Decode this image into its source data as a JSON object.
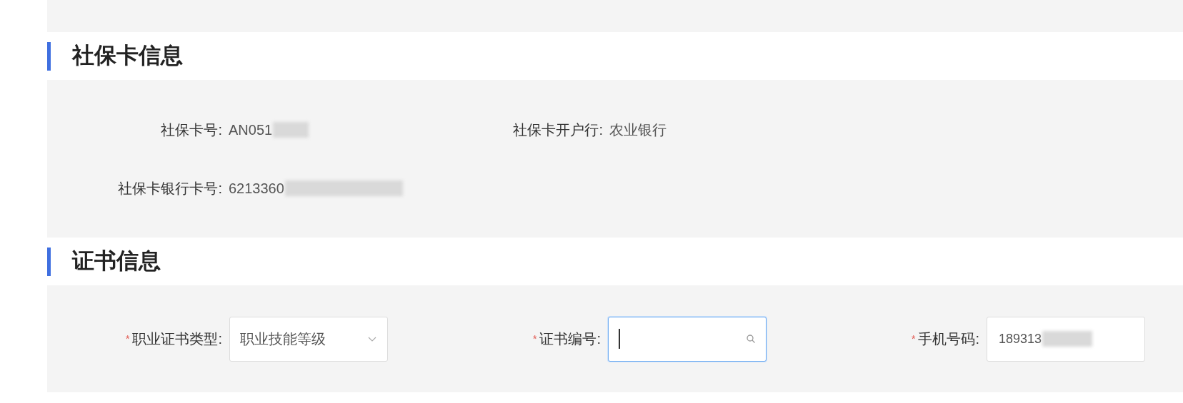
{
  "sections": [
    {
      "title": "社保卡信息",
      "kind": "info",
      "fields": [
        {
          "label": "社保卡号:",
          "value": "AN051",
          "redacted": true
        },
        {
          "label": "社保卡开户行:",
          "value": "农业银行",
          "redacted": false
        },
        {
          "label": "社保卡银行卡号:",
          "value": "6213360",
          "redacted": true
        }
      ]
    },
    {
      "title": "证书信息",
      "kind": "form",
      "fields": [
        {
          "required_mark": "*",
          "label": "职业证书类型:",
          "kind": "select",
          "value": "职业技能等级",
          "focused": false,
          "redacted": false
        },
        {
          "required_mark": "*",
          "label": "证书编号:",
          "kind": "search",
          "focused": true,
          "redacted": false
        },
        {
          "required_mark": "*",
          "label": "手机号码:",
          "kind": "text",
          "value": "189313",
          "focused": false,
          "redacted": true
        }
      ]
    }
  ]
}
